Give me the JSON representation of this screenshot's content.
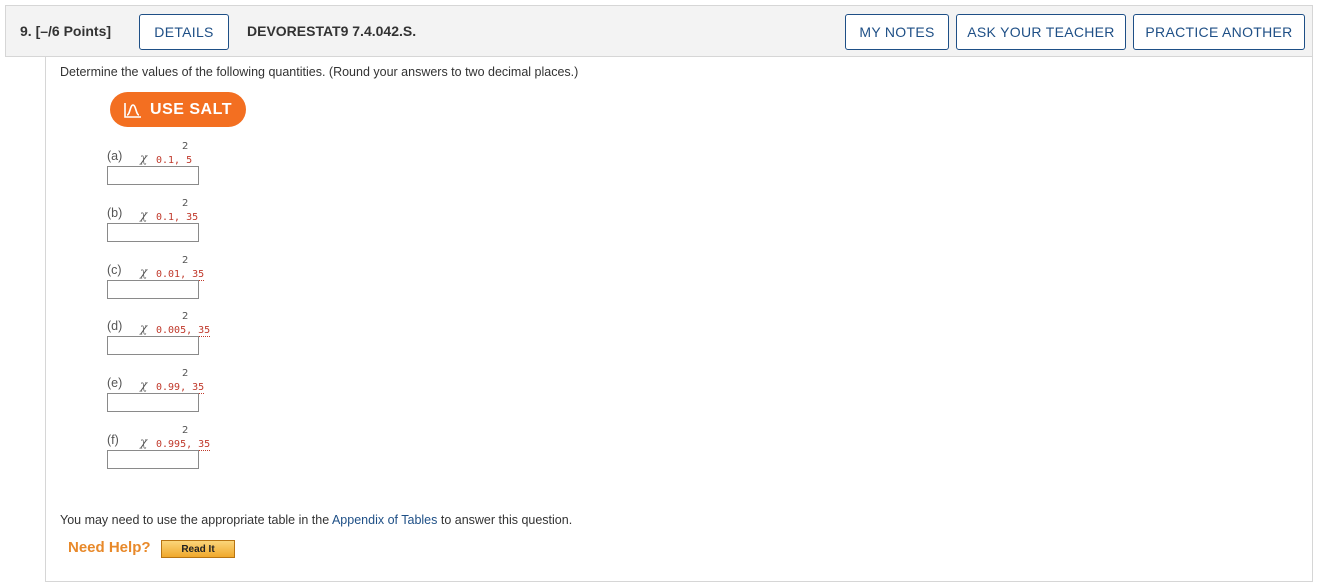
{
  "header": {
    "question_number": "9.",
    "points": "[–/6 Points]",
    "details_label": "DETAILS",
    "question_code": "DEVORESTAT9 7.4.042.S.",
    "my_notes_label": "MY NOTES",
    "ask_teacher_label": "ASK YOUR TEACHER",
    "practice_another_label": "PRACTICE ANOTHER"
  },
  "instructions": "Determine the values of the following quantities. (Round your answers to two decimal places.)",
  "salt_button": {
    "label": "USE SALT",
    "icon": "salt-chart-icon",
    "color": "#f36f21"
  },
  "parts": [
    {
      "label": "(a)",
      "symbol": "χ",
      "power": "2",
      "subscript": "0.1, 5",
      "value": ""
    },
    {
      "label": "(b)",
      "symbol": "χ",
      "power": "2",
      "subscript": "0.1, 35",
      "value": ""
    },
    {
      "label": "(c)",
      "symbol": "χ",
      "power": "2",
      "subscript": "0.01, 35",
      "value": ""
    },
    {
      "label": "(d)",
      "symbol": "χ",
      "power": "2",
      "subscript": "0.005, 35",
      "value": ""
    },
    {
      "label": "(e)",
      "symbol": "χ",
      "power": "2",
      "subscript": "0.99, 35",
      "value": ""
    },
    {
      "label": "(f)",
      "symbol": "χ",
      "power": "2",
      "subscript": "0.995, 35",
      "value": ""
    }
  ],
  "footnote": {
    "before": "You may need to use the appropriate table in the ",
    "link": "Appendix of Tables",
    "after": " to answer this question."
  },
  "help": {
    "label": "Need Help?",
    "read_it_label": "Read It"
  },
  "colors": {
    "accent": "#1e4f86",
    "salt": "#f36f21",
    "subscript": "#c0392b",
    "help": "#e8892a"
  }
}
